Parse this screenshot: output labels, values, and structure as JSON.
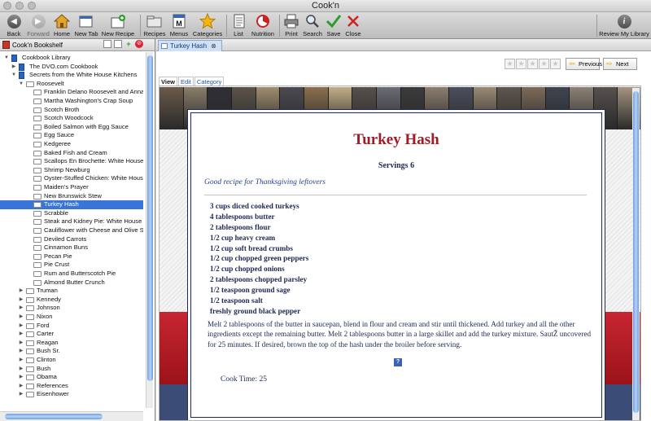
{
  "window": {
    "title": "Cook'n"
  },
  "toolbar": {
    "back": "Back",
    "forward": "Forward",
    "home": "Home",
    "new_tab": "New Tab",
    "new_recipe": "New Recipe",
    "recipes": "Recipes",
    "menus": "Menus",
    "categories": "Categories",
    "list": "List",
    "nutrition": "Nutrition",
    "print": "Print",
    "search": "Search",
    "save": "Save",
    "close": "Close",
    "review": "Review My Library"
  },
  "sidebar": {
    "title": "Cook'n Bookshelf",
    "tree": [
      {
        "label": "Cookbook Library",
        "indent": 0,
        "kind": "book",
        "toggle": "open"
      },
      {
        "label": "The DVO.com Cookbook",
        "indent": 1,
        "kind": "book",
        "toggle": "closed"
      },
      {
        "label": "Secrets from the White House Kitchens",
        "indent": 1,
        "kind": "book",
        "toggle": "open"
      },
      {
        "label": "Roosevelt",
        "indent": 2,
        "kind": "folder",
        "toggle": "open"
      },
      {
        "label": "Franklin Delano Roosevelt and Anna",
        "indent": 3,
        "kind": "folder"
      },
      {
        "label": "Martha Washington's Crap Soup",
        "indent": 3,
        "kind": "folder"
      },
      {
        "label": "Scotch Broth",
        "indent": 3,
        "kind": "folder"
      },
      {
        "label": "Scotch Woodcock",
        "indent": 3,
        "kind": "folder"
      },
      {
        "label": "Boiled Salmon with Egg Sauce",
        "indent": 3,
        "kind": "folder"
      },
      {
        "label": "Egg Sauce",
        "indent": 3,
        "kind": "folder"
      },
      {
        "label": "Kedgeree",
        "indent": 3,
        "kind": "folder"
      },
      {
        "label": "Baked Fish and Cream",
        "indent": 3,
        "kind": "folder"
      },
      {
        "label": "Scallops En Brochette: White House",
        "indent": 3,
        "kind": "folder"
      },
      {
        "label": "Shrimp Newburg",
        "indent": 3,
        "kind": "folder"
      },
      {
        "label": "Oyster-Stuffed Chicken: White House",
        "indent": 3,
        "kind": "folder"
      },
      {
        "label": "Maiden's Prayer",
        "indent": 3,
        "kind": "folder"
      },
      {
        "label": "New Brunswick Stew",
        "indent": 3,
        "kind": "folder"
      },
      {
        "label": "Turkey Hash",
        "indent": 3,
        "kind": "folder",
        "selected": true
      },
      {
        "label": "Scrabble",
        "indent": 3,
        "kind": "folder"
      },
      {
        "label": "Steak and Kidney Pie: White House",
        "indent": 3,
        "kind": "folder"
      },
      {
        "label": "Cauliflower with Cheese and Olive Sa",
        "indent": 3,
        "kind": "folder"
      },
      {
        "label": "Deviled Carrots",
        "indent": 3,
        "kind": "folder"
      },
      {
        "label": "Cinnamon Buns",
        "indent": 3,
        "kind": "folder"
      },
      {
        "label": "Pecan Pie",
        "indent": 3,
        "kind": "folder"
      },
      {
        "label": "Pie Crust",
        "indent": 3,
        "kind": "folder"
      },
      {
        "label": "Rum and Butterscotch Pie",
        "indent": 3,
        "kind": "folder"
      },
      {
        "label": "Almond Butter Crunch",
        "indent": 3,
        "kind": "folder"
      },
      {
        "label": "Truman",
        "indent": 2,
        "kind": "folder",
        "toggle": "closed"
      },
      {
        "label": "Kennedy",
        "indent": 2,
        "kind": "folder",
        "toggle": "closed"
      },
      {
        "label": "Johnson",
        "indent": 2,
        "kind": "folder",
        "toggle": "closed"
      },
      {
        "label": "Nixon",
        "indent": 2,
        "kind": "folder",
        "toggle": "closed"
      },
      {
        "label": "Ford",
        "indent": 2,
        "kind": "folder",
        "toggle": "closed"
      },
      {
        "label": "Carter",
        "indent": 2,
        "kind": "folder",
        "toggle": "closed"
      },
      {
        "label": "Reagan",
        "indent": 2,
        "kind": "folder",
        "toggle": "closed"
      },
      {
        "label": "Bush Sr.",
        "indent": 2,
        "kind": "folder",
        "toggle": "closed"
      },
      {
        "label": "Clinton",
        "indent": 2,
        "kind": "folder",
        "toggle": "closed"
      },
      {
        "label": "Bush",
        "indent": 2,
        "kind": "folder",
        "toggle": "closed"
      },
      {
        "label": "Obama",
        "indent": 2,
        "kind": "folder",
        "toggle": "closed"
      },
      {
        "label": "References",
        "indent": 2,
        "kind": "folder",
        "toggle": "closed"
      },
      {
        "label": "Eisenhower",
        "indent": 2,
        "kind": "folder",
        "toggle": "closed"
      }
    ]
  },
  "main": {
    "tab_title": "Turkey Hash",
    "nav": {
      "previous": "Previous",
      "next": "Next"
    },
    "view_tabs": [
      "View",
      "Edit",
      "Category"
    ],
    "rating": {
      "value": 0,
      "max": 5
    },
    "recipe": {
      "title": "Turkey Hash",
      "servings": "Servings 6",
      "description": "Good recipe for Thanksgiving leftovers",
      "ingredients": [
        "3 cups diced cooked turkeys",
        "4 tablespoons butter",
        "2 tablespoons flour",
        "1/2 cup heavy cream",
        "1/2 cup soft bread crumbs",
        "1/2 cup chopped green peppers",
        "1/2 cup chopped onions",
        "2 tablespoons chopped parsley",
        "1/2 teaspoon ground sage",
        "1/2 teaspoon salt",
        "freshly ground black pepper"
      ],
      "instructions": "Melt 2 tablespoons of the butter in saucepan, blend in flour and cream and stir until thickened. Add turkey and all the other ingredients except the remaining butter. Melt 2 tablespoons butter in a large skillet and add the turkey mixture. SautŽ uncovered for 25 minutes. If desired, brown the top of the hash under the broiler before serving.",
      "help": "?",
      "cook_time": "Cook Time: 25"
    }
  },
  "colors": {
    "title_red": "#9f1c26",
    "text_navy": "#1e2a52",
    "selection": "#3875d7",
    "banner_red": "#c72631",
    "banner_blue": "#3b4d77"
  },
  "photos": [
    "#6b5a4a",
    "#8a7d6a",
    "#2f2f35",
    "#5c534a",
    "#a08d6e",
    "#4c4a50",
    "#8c6f4d",
    "#c1ae86",
    "#57504c",
    "#6a6c76",
    "#3c3a3c",
    "#8b7e6e",
    "#4a4f5c",
    "#9a8a74",
    "#5f574f",
    "#7d6b59",
    "#3e4450",
    "#8d8275",
    "#55514f",
    "#a59480"
  ]
}
